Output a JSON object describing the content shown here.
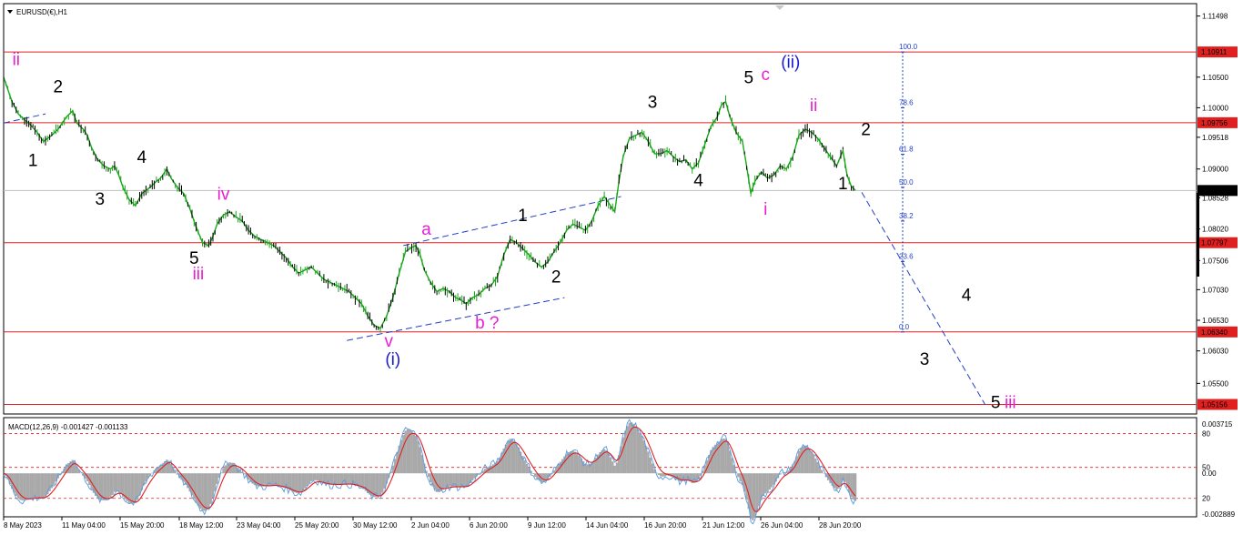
{
  "header": {
    "symbol_label": "EURUSD(€),H1"
  },
  "macd": {
    "label": "MACD(12,26,9) -0.001427 -0.001133",
    "axis_labels": [
      {
        "text": "0.003715",
        "v": 0.003715
      },
      {
        "text": "80",
        "v": 0.0027
      },
      {
        "text": "50",
        "v": 0.0004
      },
      {
        "text": "0.00",
        "v": 0.0
      },
      {
        "text": "20",
        "v": -0.0017
      },
      {
        "text": "-0.002889",
        "v": -0.002889
      }
    ]
  },
  "chart_data": {
    "type": "line",
    "symbol": "EURUSD(€)",
    "timeframe": "H1",
    "ylim": [
      1.05,
      1.117
    ],
    "price_ticks": [
      1.11498,
      1.105,
      1.1,
      1.09518,
      1.09,
      1.08528,
      1.0802,
      1.07506,
      1.0703,
      1.0653,
      1.0603,
      1.055
    ],
    "time_labels": [
      "8 May 2023",
      "11 May 04:00",
      "15 May 20:00",
      "18 May 12:00",
      "23 May 04:00",
      "25 May 20:00",
      "30 May 12:00",
      "2 Jun 04:00",
      "6 Jun 20:00",
      "9 Jun 12:00",
      "14 Jun 04:00",
      "16 Jun 20:00",
      "21 Jun 12:00",
      "26 Jun 04:00",
      "28 Jun 20:00"
    ],
    "current_price": {
      "label": "1.08649",
      "value": 1.08649
    },
    "horizontal_levels": [
      {
        "label": "1.10911",
        "value": 1.10911
      },
      {
        "label": "1.09756",
        "value": 1.09756
      },
      {
        "label": "1.07797",
        "value": 1.07797
      },
      {
        "label": "1.06340",
        "value": 1.0634
      },
      {
        "label": "1.05156",
        "value": 1.05156
      }
    ],
    "fibonacci": [
      {
        "label": "100.0",
        "value": 1.10911
      },
      {
        "label": "78.6",
        "value": 1.1
      },
      {
        "label": "61.8",
        "value": 1.0924
      },
      {
        "label": "50.0",
        "value": 1.087
      },
      {
        "label": "38.2",
        "value": 1.0815
      },
      {
        "label": "23.6",
        "value": 1.0749
      },
      {
        "label": "0.0",
        "value": 1.0634
      }
    ],
    "price_path": [
      {
        "x": 0,
        "y": 1.105
      },
      {
        "x": 4,
        "y": 1.101
      },
      {
        "x": 7,
        "y": 1.099
      },
      {
        "x": 10,
        "y": 1.098
      },
      {
        "x": 12,
        "y": 1.0975
      },
      {
        "x": 16,
        "y": 1.096
      },
      {
        "x": 19,
        "y": 1.0945
      },
      {
        "x": 23,
        "y": 1.0955
      },
      {
        "x": 26,
        "y": 1.0965
      },
      {
        "x": 30,
        "y": 1.0985
      },
      {
        "x": 33,
        "y": 1.0995
      },
      {
        "x": 35,
        "y": 1.0975
      },
      {
        "x": 38,
        "y": 1.0965
      },
      {
        "x": 40,
        "y": 1.0955
      },
      {
        "x": 42,
        "y": 1.0935
      },
      {
        "x": 45,
        "y": 1.0915
      },
      {
        "x": 48,
        "y": 1.0905
      },
      {
        "x": 51,
        "y": 1.09
      },
      {
        "x": 53,
        "y": 1.0905
      },
      {
        "x": 55,
        "y": 1.089
      },
      {
        "x": 57,
        "y": 1.087
      },
      {
        "x": 60,
        "y": 1.085
      },
      {
        "x": 63,
        "y": 1.084
      },
      {
        "x": 66,
        "y": 1.086
      },
      {
        "x": 70,
        "y": 1.087
      },
      {
        "x": 73,
        "y": 1.088
      },
      {
        "x": 75,
        "y": 1.0885
      },
      {
        "x": 78,
        "y": 1.09
      },
      {
        "x": 80,
        "y": 1.0885
      },
      {
        "x": 83,
        "y": 1.087
      },
      {
        "x": 86,
        "y": 1.086
      },
      {
        "x": 89,
        "y": 1.0835
      },
      {
        "x": 92,
        "y": 1.0805
      },
      {
        "x": 95,
        "y": 1.078
      },
      {
        "x": 98,
        "y": 1.0775
      },
      {
        "x": 100,
        "y": 1.079
      },
      {
        "x": 102,
        "y": 1.081
      },
      {
        "x": 105,
        "y": 1.0825
      },
      {
        "x": 108,
        "y": 1.083
      },
      {
        "x": 111,
        "y": 1.0822
      },
      {
        "x": 114,
        "y": 1.0815
      },
      {
        "x": 117,
        "y": 1.08
      },
      {
        "x": 120,
        "y": 1.079
      },
      {
        "x": 123,
        "y": 1.0785
      },
      {
        "x": 126,
        "y": 1.078
      },
      {
        "x": 129,
        "y": 1.0775
      },
      {
        "x": 132,
        "y": 1.0765
      },
      {
        "x": 135,
        "y": 1.0755
      },
      {
        "x": 138,
        "y": 1.074
      },
      {
        "x": 141,
        "y": 1.073
      },
      {
        "x": 144,
        "y": 1.0735
      },
      {
        "x": 147,
        "y": 1.074
      },
      {
        "x": 150,
        "y": 1.073
      },
      {
        "x": 153,
        "y": 1.072
      },
      {
        "x": 156,
        "y": 1.0715
      },
      {
        "x": 159,
        "y": 1.071
      },
      {
        "x": 162,
        "y": 1.0705
      },
      {
        "x": 165,
        "y": 1.07
      },
      {
        "x": 168,
        "y": 1.069
      },
      {
        "x": 171,
        "y": 1.068
      },
      {
        "x": 174,
        "y": 1.066
      },
      {
        "x": 177,
        "y": 1.0645
      },
      {
        "x": 180,
        "y": 1.064
      },
      {
        "x": 183,
        "y": 1.066
      },
      {
        "x": 186,
        "y": 1.069
      },
      {
        "x": 189,
        "y": 1.073
      },
      {
        "x": 192,
        "y": 1.0765
      },
      {
        "x": 195,
        "y": 1.0772
      },
      {
        "x": 197,
        "y": 1.0775
      },
      {
        "x": 199,
        "y": 1.076
      },
      {
        "x": 201,
        "y": 1.0735
      },
      {
        "x": 204,
        "y": 1.0715
      },
      {
        "x": 207,
        "y": 1.07
      },
      {
        "x": 210,
        "y": 1.0705
      },
      {
        "x": 213,
        "y": 1.07
      },
      {
        "x": 216,
        "y": 1.069
      },
      {
        "x": 219,
        "y": 1.0685
      },
      {
        "x": 221,
        "y": 1.068
      },
      {
        "x": 224,
        "y": 1.069
      },
      {
        "x": 227,
        "y": 1.0695
      },
      {
        "x": 230,
        "y": 1.0705
      },
      {
        "x": 233,
        "y": 1.071
      },
      {
        "x": 236,
        "y": 1.0725
      },
      {
        "x": 239,
        "y": 1.076
      },
      {
        "x": 242,
        "y": 1.0785
      },
      {
        "x": 245,
        "y": 1.078
      },
      {
        "x": 248,
        "y": 1.077
      },
      {
        "x": 251,
        "y": 1.076
      },
      {
        "x": 254,
        "y": 1.0748
      },
      {
        "x": 257,
        "y": 1.074
      },
      {
        "x": 260,
        "y": 1.0748
      },
      {
        "x": 263,
        "y": 1.0765
      },
      {
        "x": 266,
        "y": 1.078
      },
      {
        "x": 269,
        "y": 1.08
      },
      {
        "x": 272,
        "y": 1.081
      },
      {
        "x": 275,
        "y": 1.0805
      },
      {
        "x": 278,
        "y": 1.08
      },
      {
        "x": 281,
        "y": 1.0815
      },
      {
        "x": 284,
        "y": 1.084
      },
      {
        "x": 287,
        "y": 1.0855
      },
      {
        "x": 290,
        "y": 1.084
      },
      {
        "x": 292,
        "y": 1.083
      },
      {
        "x": 294,
        "y": 1.088
      },
      {
        "x": 296,
        "y": 1.092
      },
      {
        "x": 299,
        "y": 1.095
      },
      {
        "x": 302,
        "y": 1.0955
      },
      {
        "x": 305,
        "y": 1.096
      },
      {
        "x": 308,
        "y": 1.0945
      },
      {
        "x": 311,
        "y": 1.0925
      },
      {
        "x": 314,
        "y": 1.0925
      },
      {
        "x": 317,
        "y": 1.093
      },
      {
        "x": 320,
        "y": 1.092
      },
      {
        "x": 323,
        "y": 1.0912
      },
      {
        "x": 326,
        "y": 1.0915
      },
      {
        "x": 329,
        "y": 1.09
      },
      {
        "x": 332,
        "y": 1.091
      },
      {
        "x": 335,
        "y": 1.094
      },
      {
        "x": 338,
        "y": 1.097
      },
      {
        "x": 341,
        "y": 1.0985
      },
      {
        "x": 343,
        "y": 1.1005
      },
      {
        "x": 345,
        "y": 1.101
      },
      {
        "x": 347,
        "y": 1.0985
      },
      {
        "x": 350,
        "y": 1.096
      },
      {
        "x": 353,
        "y": 1.0945
      },
      {
        "x": 355,
        "y": 1.0905
      },
      {
        "x": 357,
        "y": 1.086
      },
      {
        "x": 359,
        "y": 1.088
      },
      {
        "x": 362,
        "y": 1.0895
      },
      {
        "x": 365,
        "y": 1.0885
      },
      {
        "x": 368,
        "y": 1.089
      },
      {
        "x": 371,
        "y": 1.0905
      },
      {
        "x": 374,
        "y": 1.09
      },
      {
        "x": 377,
        "y": 1.092
      },
      {
        "x": 380,
        "y": 1.0955
      },
      {
        "x": 383,
        "y": 1.0965
      },
      {
        "x": 386,
        "y": 1.096
      },
      {
        "x": 389,
        "y": 1.095
      },
      {
        "x": 392,
        "y": 1.0935
      },
      {
        "x": 395,
        "y": 1.092
      },
      {
        "x": 398,
        "y": 1.0905
      },
      {
        "x": 401,
        "y": 1.093
      },
      {
        "x": 403,
        "y": 1.089
      },
      {
        "x": 405,
        "y": 1.0872
      },
      {
        "x": 407,
        "y": 1.0865
      }
    ],
    "price_x_range": [
      0,
      407
    ],
    "trend_lines": [
      {
        "name": "channel-upper",
        "style": "dashed",
        "from": {
          "x": 191,
          "y": 1.0775
        },
        "to": {
          "x": 295,
          "y": 1.0855
        }
      },
      {
        "name": "channel-lower",
        "style": "dashed",
        "from": {
          "x": 164,
          "y": 1.062
        },
        "to": {
          "x": 268,
          "y": 1.069
        }
      },
      {
        "name": "left-line",
        "style": "dashed",
        "from": {
          "x": 0,
          "y": 1.0975
        },
        "to": {
          "x": 20,
          "y": 1.099
        }
      },
      {
        "name": "projection",
        "style": "dashed",
        "from": {
          "x": 410,
          "y": 1.0862
        },
        "to": {
          "x": 469,
          "y": 1.0515
        }
      }
    ],
    "wave_labels": [
      {
        "text": "ii",
        "color": "#e81fd3",
        "x": 6,
        "y": 1.107
      },
      {
        "text": "2",
        "color": "#000000",
        "x": 26,
        "y": 1.1025
      },
      {
        "text": "1",
        "color": "#000000",
        "x": 14,
        "y": 1.0905
      },
      {
        "text": "4",
        "color": "#000000",
        "x": 66,
        "y": 1.091
      },
      {
        "text": "3",
        "color": "#000000",
        "x": 46,
        "y": 1.0842
      },
      {
        "text": "iv",
        "color": "#e81fd3",
        "x": 105,
        "y": 1.085
      },
      {
        "text": "5",
        "color": "#000000",
        "x": 91,
        "y": 1.0745
      },
      {
        "text": "iii",
        "color": "#e81fd3",
        "x": 93,
        "y": 1.072
      },
      {
        "text": "a",
        "color": "#e81fd3",
        "x": 202,
        "y": 1.0793
      },
      {
        "text": "1",
        "color": "#000000",
        "x": 248,
        "y": 1.0815
      },
      {
        "text": "2",
        "color": "#000000",
        "x": 264,
        "y": 1.0715
      },
      {
        "text": "b ?",
        "color": "#e81fd3",
        "x": 231,
        "y": 1.064
      },
      {
        "text": "v",
        "color": "#e81fd3",
        "x": 184,
        "y": 1.061
      },
      {
        "text": "(i)",
        "color": "#1a1ad0",
        "x": 186,
        "y": 1.058
      },
      {
        "text": "3",
        "color": "#000000",
        "x": 310,
        "y": 1.1
      },
      {
        "text": "4",
        "color": "#000000",
        "x": 332,
        "y": 1.0872
      },
      {
        "text": "5",
        "color": "#000000",
        "x": 356,
        "y": 1.104
      },
      {
        "text": "c",
        "color": "#e81fd3",
        "x": 364,
        "y": 1.1045
      },
      {
        "text": "(ii)",
        "color": "#1a1ad0",
        "x": 376,
        "y": 1.1065
      },
      {
        "text": "ii",
        "color": "#e81fd3",
        "x": 387,
        "y": 1.0995
      },
      {
        "text": "i",
        "color": "#e81fd3",
        "x": 364,
        "y": 1.0825
      },
      {
        "text": "2",
        "color": "#000000",
        "x": 412,
        "y": 1.0955
      },
      {
        "text": "1",
        "color": "#000000",
        "x": 401,
        "y": 1.0867
      },
      {
        "text": "4",
        "color": "#000000",
        "x": 460,
        "y": 1.0685
      },
      {
        "text": "3",
        "color": "#000000",
        "x": 440,
        "y": 1.058
      },
      {
        "text": "5",
        "color": "#000000",
        "x": 474,
        "y": 1.051
      },
      {
        "text": "iii",
        "color": "#e81fd3",
        "x": 481,
        "y": 1.051
      }
    ],
    "colors": {
      "price": "#1aa61a",
      "levels": "#e02020",
      "trend": "#1f3fc4",
      "macd_hist": "#a9a9a9",
      "macd_line": "#5a9be0",
      "signal_line": "#e02020",
      "price_tag": "#e02020",
      "current_tag": "#000000"
    },
    "grid": false
  }
}
